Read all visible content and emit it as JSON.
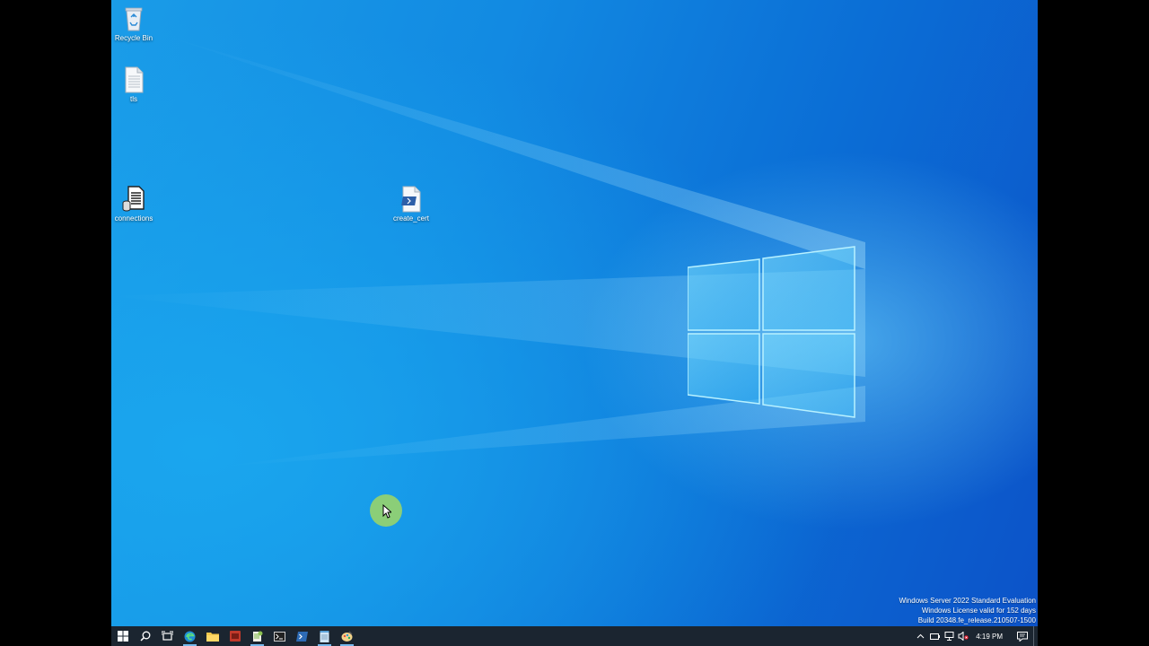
{
  "desktop": {
    "icons": [
      {
        "label": "Recycle Bin",
        "icon": "recycle-bin-icon"
      },
      {
        "label": "tls",
        "icon": "text-file-icon"
      },
      {
        "label": "connections",
        "icon": "connections-file-icon"
      },
      {
        "label": "create_cert",
        "icon": "powershell-script-icon"
      }
    ]
  },
  "watermark": {
    "line1": "Windows Server 2022 Standard Evaluation",
    "line2": "Windows License valid for 152 days",
    "line3": "Build 20348.fe_release.210507-1500"
  },
  "taskbar": {
    "buttons": [
      "start-icon",
      "search-icon",
      "task-view-icon",
      "edge-icon",
      "file-explorer-icon",
      "app-icon",
      "notepad-plus-icon",
      "terminal-icon",
      "powershell-ise-icon",
      "notepad-icon",
      "paint-icon"
    ],
    "tray": {
      "time": "4:19 PM"
    }
  },
  "colors": {
    "taskbar": "#1b2530",
    "accent": "#76b9ed",
    "desktop": "#0f7fdc"
  }
}
